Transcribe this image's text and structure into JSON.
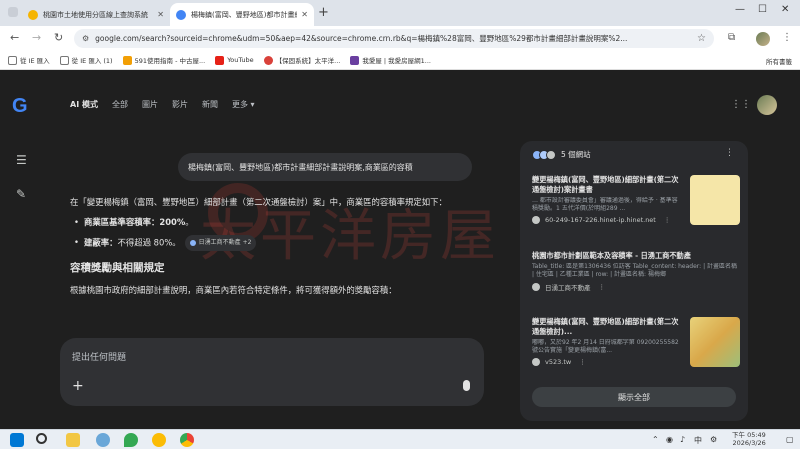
{
  "browser": {
    "tabs": [
      {
        "title": "桃園市土地使用分區線上查詢系統",
        "active": false
      },
      {
        "title": "楊梅鎮(富岡、豐野地區)都市計畫細部計畫說明...",
        "active": true
      }
    ],
    "url": "google.com/search?sourceid=chrome&udm=50&aep=42&source=chrome.crn.rb&q=楊梅鎮%28富岡、豐野地區%29都市計畫細部計畫說明案%2...",
    "bookmarks": [
      "從 IE 匯入",
      "從 IE 匯入 (1)",
      "591使用指南 - 中古屋...",
      "YouTube",
      "【保固系統】太平洋...",
      "我愛屋 | 我愛房屋網1..."
    ],
    "bookmarks_right": "所有書籤"
  },
  "google": {
    "logo": "G",
    "nav_tabs": [
      "AI 模式",
      "全部",
      "圖片",
      "影片",
      "新聞",
      "更多 ▾"
    ],
    "query": "楊梅鎮(富岡、豐野地區)都市計畫細部計畫說明案,商業區的容積",
    "answer": {
      "intro": "在「變更楊梅鎮（富岡、豐野地區）細部計畫（第二次通盤檢討）案」中，商業區的容積率規定如下：",
      "bullet1_label": "商業區基準容積率：",
      "bullet1_value": "200%",
      "bullet1_tail": "。",
      "bullet2_label": "建蔽率：",
      "bullet2_text": "不得超過 80%。",
      "chip_text": "日湧工商不動產 +2",
      "heading": "容積獎勵與相關規定",
      "para": "根據桃園市政府的細部計畫說明，商業區內若符合特定條件，將可獲得額外的獎勵容積："
    },
    "watermark": "太平洋房屋",
    "ask_placeholder": "提出任何問題",
    "sources": {
      "count_label": "5 個網站",
      "items": [
        {
          "title": "變更楊梅鎮(富岡、豐野地區)細部計畫(第二次通盤檢討)案計畫書",
          "desc": "… 都市設計審議委員會」審議通過後，得給予 · 基準容積獎勵。1 五代洋價(於明組289 ...",
          "site": "60-249-167-226.hinet-ip.hinet.net"
        },
        {
          "title": "桃園市都市計劃區範本及容積率 - 日湧工商不動產",
          "desc": "Table_title: 區是第1306436 位訪客 Table_content: header: | 計畫區名稱 | 住宅區 | 乙種工業區 | row: | 計畫區名稱: 楊梅鄉",
          "site": "日湧工商不動產"
        },
        {
          "title": "變更楊梅鎮(富岡、豐野地區)細部計畫(第二次通盤檢討)...",
          "desc": "嘟嘟，又於92 年2 月14 日府城都字第 09200255582 號公告實施「變更楊梅鎮(富...",
          "site": "v523.tw"
        }
      ],
      "show_all": "顯示全部"
    }
  },
  "taskbar": {
    "time": "下午 05:49",
    "date": "2026/3/26",
    "ime": "中"
  }
}
